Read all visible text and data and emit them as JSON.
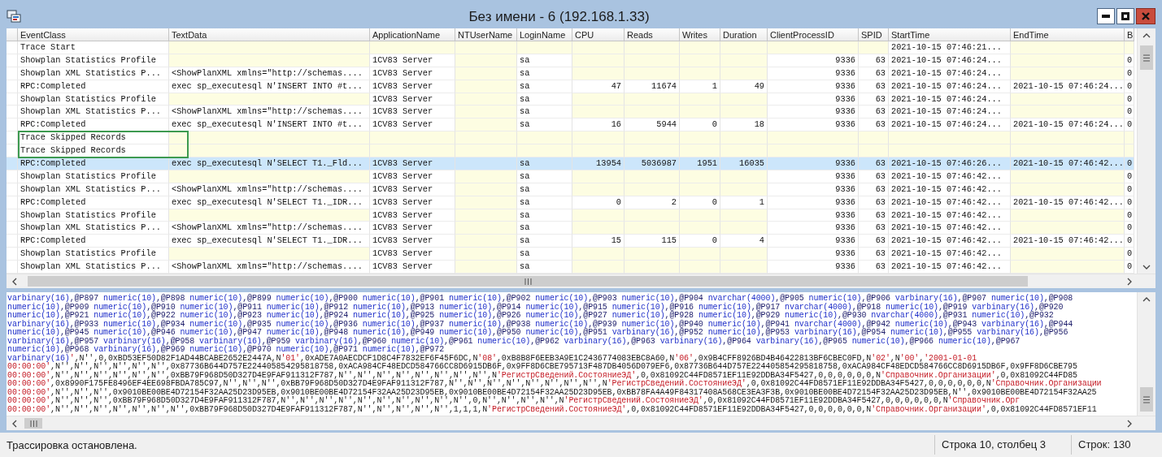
{
  "window": {
    "title": "Без имени - 6 (192.168.1.33)"
  },
  "table": {
    "columns": [
      {
        "label": "EventClass",
        "kind": "text"
      },
      {
        "label": "TextData",
        "kind": "text"
      },
      {
        "label": "ApplicationName",
        "kind": "text"
      },
      {
        "label": "NTUserName",
        "kind": "text"
      },
      {
        "label": "LoginName",
        "kind": "text"
      },
      {
        "label": "CPU",
        "kind": "number"
      },
      {
        "label": "Reads",
        "kind": "number"
      },
      {
        "label": "Writes",
        "kind": "number"
      },
      {
        "label": "Duration",
        "kind": "number"
      },
      {
        "label": "ClientProcessID",
        "kind": "number"
      },
      {
        "label": "SPID",
        "kind": "number"
      },
      {
        "label": "StartTime",
        "kind": "text"
      },
      {
        "label": "EndTime",
        "kind": "text"
      },
      {
        "label": "B",
        "kind": "text"
      }
    ],
    "rows": [
      {
        "selected": false,
        "highlighted": false,
        "cells": [
          "Trace Start",
          null,
          null,
          null,
          null,
          null,
          null,
          null,
          null,
          null,
          null,
          "2021-10-15 07:46:21...",
          null,
          null
        ]
      },
      {
        "selected": false,
        "highlighted": false,
        "cells": [
          "Showplan Statistics Profile",
          null,
          "1CV83 Server",
          null,
          "sa",
          null,
          null,
          null,
          null,
          "9336",
          "63",
          "2021-10-15 07:46:24...",
          null,
          "0"
        ]
      },
      {
        "selected": false,
        "highlighted": false,
        "cells": [
          "Showplan XML Statistics P...",
          "<ShowPlanXML xmlns=\"http://schemas....",
          "1CV83 Server",
          null,
          "sa",
          null,
          null,
          null,
          null,
          "9336",
          "63",
          "2021-10-15 07:46:24...",
          null,
          "0"
        ]
      },
      {
        "selected": false,
        "highlighted": false,
        "cells": [
          "RPC:Completed",
          "exec sp_executesql N'INSERT INTO #t...",
          "1CV83 Server",
          null,
          "sa",
          "47",
          "11674",
          "1",
          "49",
          "9336",
          "63",
          "2021-10-15 07:46:24...",
          "2021-10-15 07:46:24...",
          "0"
        ]
      },
      {
        "selected": false,
        "highlighted": false,
        "cells": [
          "Showplan Statistics Profile",
          null,
          "1CV83 Server",
          null,
          "sa",
          null,
          null,
          null,
          null,
          "9336",
          "63",
          "2021-10-15 07:46:24...",
          null,
          "0"
        ]
      },
      {
        "selected": false,
        "highlighted": false,
        "cells": [
          "Showplan XML Statistics P...",
          "<ShowPlanXML xmlns=\"http://schemas....",
          "1CV83 Server",
          null,
          "sa",
          null,
          null,
          null,
          null,
          "9336",
          "63",
          "2021-10-15 07:46:24...",
          null,
          "0"
        ]
      },
      {
        "selected": false,
        "highlighted": false,
        "cells": [
          "RPC:Completed",
          "exec sp_executesql N'INSERT INTO #t...",
          "1CV83 Server",
          null,
          "sa",
          "16",
          "5944",
          "0",
          "18",
          "9336",
          "63",
          "2021-10-15 07:46:24...",
          "2021-10-15 07:46:24...",
          "0"
        ]
      },
      {
        "selected": false,
        "highlighted": true,
        "cells": [
          "Trace Skipped Records",
          null,
          null,
          null,
          null,
          null,
          null,
          null,
          null,
          null,
          null,
          null,
          null,
          null
        ]
      },
      {
        "selected": false,
        "highlighted": true,
        "cells": [
          "Trace Skipped Records",
          null,
          null,
          null,
          null,
          null,
          null,
          null,
          null,
          null,
          null,
          null,
          null,
          null
        ]
      },
      {
        "selected": true,
        "highlighted": false,
        "cells": [
          "RPC:Completed",
          "exec sp_executesql N'SELECT T1._Fld...",
          "1CV83 Server",
          null,
          "sa",
          "13954",
          "5036987",
          "1951",
          "16035",
          "9336",
          "63",
          "2021-10-15 07:46:26...",
          "2021-10-15 07:46:42...",
          "0"
        ]
      },
      {
        "selected": false,
        "highlighted": false,
        "cells": [
          "Showplan Statistics Profile",
          null,
          "1CV83 Server",
          null,
          "sa",
          null,
          null,
          null,
          null,
          "9336",
          "63",
          "2021-10-15 07:46:42...",
          null,
          "0"
        ]
      },
      {
        "selected": false,
        "highlighted": false,
        "cells": [
          "Showplan XML Statistics P...",
          "<ShowPlanXML xmlns=\"http://schemas....",
          "1CV83 Server",
          null,
          "sa",
          null,
          null,
          null,
          null,
          "9336",
          "63",
          "2021-10-15 07:46:42...",
          null,
          "0"
        ]
      },
      {
        "selected": false,
        "highlighted": false,
        "cells": [
          "RPC:Completed",
          "exec sp_executesql N'SELECT T1._IDR...",
          "1CV83 Server",
          null,
          "sa",
          "0",
          "2",
          "0",
          "1",
          "9336",
          "63",
          "2021-10-15 07:46:42...",
          "2021-10-15 07:46:42...",
          "0"
        ]
      },
      {
        "selected": false,
        "highlighted": false,
        "cells": [
          "Showplan Statistics Profile",
          null,
          "1CV83 Server",
          null,
          "sa",
          null,
          null,
          null,
          null,
          "9336",
          "63",
          "2021-10-15 07:46:42...",
          null,
          "0"
        ]
      },
      {
        "selected": false,
        "highlighted": false,
        "cells": [
          "Showplan XML Statistics P...",
          "<ShowPlanXML xmlns=\"http://schemas....",
          "1CV83 Server",
          null,
          "sa",
          null,
          null,
          null,
          null,
          "9336",
          "63",
          "2021-10-15 07:46:42...",
          null,
          "0"
        ]
      },
      {
        "selected": false,
        "highlighted": false,
        "cells": [
          "RPC:Completed",
          "exec sp_executesql N'SELECT T1._IDR...",
          "1CV83 Server",
          null,
          "sa",
          "15",
          "115",
          "0",
          "4",
          "9336",
          "63",
          "2021-10-15 07:46:42...",
          "2021-10-15 07:46:42...",
          "0"
        ]
      },
      {
        "selected": false,
        "highlighted": false,
        "cells": [
          "Showplan Statistics Profile",
          null,
          "1CV83 Server",
          null,
          "sa",
          null,
          null,
          null,
          null,
          "9336",
          "63",
          "2021-10-15 07:46:42...",
          null,
          "0"
        ]
      },
      {
        "selected": false,
        "highlighted": false,
        "cells": [
          "Showplan XML Statistics P...",
          "<ShowPlanXML xmlns=\"http://schemas....",
          "1CV83 Server",
          null,
          "sa",
          null,
          null,
          null,
          null,
          "9336",
          "63",
          "2021-10-15 07:46:42...",
          null,
          "0"
        ]
      }
    ]
  },
  "text_panel": {
    "lines": [
      {
        "segments": [
          {
            "kind": "kw",
            "text": "varbinary(16)"
          },
          {
            "kind": "param",
            "text": ",@P897 "
          },
          {
            "kind": "kw",
            "text": "numeric(10)"
          },
          {
            "kind": "param",
            "text": ",@P898 "
          },
          {
            "kind": "kw",
            "text": "numeric(10)"
          },
          {
            "kind": "param",
            "text": ",@P899 "
          },
          {
            "kind": "kw",
            "text": "numeric(10)"
          },
          {
            "kind": "param",
            "text": ",@P900 "
          },
          {
            "kind": "kw",
            "text": "numeric(10)"
          },
          {
            "kind": "param",
            "text": ",@P901 "
          },
          {
            "kind": "kw",
            "text": "numeric(10)"
          },
          {
            "kind": "param",
            "text": ",@P902 "
          },
          {
            "kind": "kw",
            "text": "numeric(10)"
          },
          {
            "kind": "param",
            "text": ",@P903 "
          },
          {
            "kind": "kw",
            "text": "numeric(10)"
          },
          {
            "kind": "param",
            "text": ",@P904 "
          },
          {
            "kind": "kw",
            "text": "nvarchar(4000)"
          },
          {
            "kind": "param",
            "text": ",@P905 "
          },
          {
            "kind": "kw",
            "text": "numeric(10)"
          },
          {
            "kind": "param",
            "text": ",@P906 "
          },
          {
            "kind": "kw",
            "text": "varbinary(16)"
          },
          {
            "kind": "param",
            "text": ",@P907 "
          },
          {
            "kind": "kw",
            "text": "numeric(10)"
          },
          {
            "kind": "param",
            "text": ",@P908"
          }
        ]
      },
      {
        "segments": [
          {
            "kind": "kw",
            "text": "numeric(10)"
          },
          {
            "kind": "param",
            "text": ",@P909 "
          },
          {
            "kind": "kw",
            "text": "numeric(10)"
          },
          {
            "kind": "param",
            "text": ",@P910 "
          },
          {
            "kind": "kw",
            "text": "numeric(10)"
          },
          {
            "kind": "param",
            "text": ",@P911 "
          },
          {
            "kind": "kw",
            "text": "numeric(10)"
          },
          {
            "kind": "param",
            "text": ",@P912 "
          },
          {
            "kind": "kw",
            "text": "numeric(10)"
          },
          {
            "kind": "param",
            "text": ",@P913 "
          },
          {
            "kind": "kw",
            "text": "numeric(10)"
          },
          {
            "kind": "param",
            "text": ",@P914 "
          },
          {
            "kind": "kw",
            "text": "numeric(10)"
          },
          {
            "kind": "param",
            "text": ",@P915 "
          },
          {
            "kind": "kw",
            "text": "numeric(10)"
          },
          {
            "kind": "param",
            "text": ",@P916 "
          },
          {
            "kind": "kw",
            "text": "numeric(10)"
          },
          {
            "kind": "param",
            "text": ",@P917 "
          },
          {
            "kind": "kw",
            "text": "nvarchar(4000)"
          },
          {
            "kind": "param",
            "text": ",@P918 "
          },
          {
            "kind": "kw",
            "text": "numeric(10)"
          },
          {
            "kind": "param",
            "text": ",@P919 "
          },
          {
            "kind": "kw",
            "text": "varbinary(16)"
          },
          {
            "kind": "param",
            "text": ",@P920"
          }
        ]
      },
      {
        "segments": [
          {
            "kind": "kw",
            "text": "numeric(10)"
          },
          {
            "kind": "param",
            "text": ",@P921 "
          },
          {
            "kind": "kw",
            "text": "numeric(10)"
          },
          {
            "kind": "param",
            "text": ",@P922 "
          },
          {
            "kind": "kw",
            "text": "numeric(10)"
          },
          {
            "kind": "param",
            "text": ",@P923 "
          },
          {
            "kind": "kw",
            "text": "numeric(10)"
          },
          {
            "kind": "param",
            "text": ",@P924 "
          },
          {
            "kind": "kw",
            "text": "numeric(10)"
          },
          {
            "kind": "param",
            "text": ",@P925 "
          },
          {
            "kind": "kw",
            "text": "numeric(10)"
          },
          {
            "kind": "param",
            "text": ",@P926 "
          },
          {
            "kind": "kw",
            "text": "numeric(10)"
          },
          {
            "kind": "param",
            "text": ",@P927 "
          },
          {
            "kind": "kw",
            "text": "numeric(10)"
          },
          {
            "kind": "param",
            "text": ",@P928 "
          },
          {
            "kind": "kw",
            "text": "numeric(10)"
          },
          {
            "kind": "param",
            "text": ",@P929 "
          },
          {
            "kind": "kw",
            "text": "numeric(10)"
          },
          {
            "kind": "param",
            "text": ",@P930 "
          },
          {
            "kind": "kw",
            "text": "nvarchar(4000)"
          },
          {
            "kind": "param",
            "text": ",@P931 "
          },
          {
            "kind": "kw",
            "text": "numeric(10)"
          },
          {
            "kind": "param",
            "text": ",@P932"
          }
        ]
      },
      {
        "segments": [
          {
            "kind": "kw",
            "text": "varbinary(16)"
          },
          {
            "kind": "param",
            "text": ",@P933 "
          },
          {
            "kind": "kw",
            "text": "numeric(10)"
          },
          {
            "kind": "param",
            "text": ",@P934 "
          },
          {
            "kind": "kw",
            "text": "numeric(10)"
          },
          {
            "kind": "param",
            "text": ",@P935 "
          },
          {
            "kind": "kw",
            "text": "numeric(10)"
          },
          {
            "kind": "param",
            "text": ",@P936 "
          },
          {
            "kind": "kw",
            "text": "numeric(10)"
          },
          {
            "kind": "param",
            "text": ",@P937 "
          },
          {
            "kind": "kw",
            "text": "numeric(10)"
          },
          {
            "kind": "param",
            "text": ",@P938 "
          },
          {
            "kind": "kw",
            "text": "numeric(10)"
          },
          {
            "kind": "param",
            "text": ",@P939 "
          },
          {
            "kind": "kw",
            "text": "numeric(10)"
          },
          {
            "kind": "param",
            "text": ",@P940 "
          },
          {
            "kind": "kw",
            "text": "numeric(10)"
          },
          {
            "kind": "param",
            "text": ",@P941 "
          },
          {
            "kind": "kw",
            "text": "nvarchar(4000)"
          },
          {
            "kind": "param",
            "text": ",@P942 "
          },
          {
            "kind": "kw",
            "text": "numeric(10)"
          },
          {
            "kind": "param",
            "text": ",@P943 "
          },
          {
            "kind": "kw",
            "text": "varbinary(16)"
          },
          {
            "kind": "param",
            "text": ",@P944"
          }
        ]
      },
      {
        "segments": [
          {
            "kind": "kw",
            "text": "numeric(10)"
          },
          {
            "kind": "param",
            "text": ",@P945 "
          },
          {
            "kind": "kw",
            "text": "numeric(10)"
          },
          {
            "kind": "param",
            "text": ",@P946 "
          },
          {
            "kind": "kw",
            "text": "numeric(10)"
          },
          {
            "kind": "param",
            "text": ",@P947 "
          },
          {
            "kind": "kw",
            "text": "numeric(10)"
          },
          {
            "kind": "param",
            "text": ",@P948 "
          },
          {
            "kind": "kw",
            "text": "numeric(10)"
          },
          {
            "kind": "param",
            "text": ",@P949 "
          },
          {
            "kind": "kw",
            "text": "numeric(10)"
          },
          {
            "kind": "param",
            "text": ",@P950 "
          },
          {
            "kind": "kw",
            "text": "numeric(10)"
          },
          {
            "kind": "param",
            "text": ",@P951 "
          },
          {
            "kind": "kw",
            "text": "varbinary(16)"
          },
          {
            "kind": "param",
            "text": ",@P952 "
          },
          {
            "kind": "kw",
            "text": "numeric(10)"
          },
          {
            "kind": "param",
            "text": ",@P953 "
          },
          {
            "kind": "kw",
            "text": "varbinary(16)"
          },
          {
            "kind": "param",
            "text": ",@P954 "
          },
          {
            "kind": "kw",
            "text": "numeric(10)"
          },
          {
            "kind": "param",
            "text": ",@P955 "
          },
          {
            "kind": "kw",
            "text": "varbinary(16)"
          },
          {
            "kind": "param",
            "text": ",@P956"
          }
        ]
      },
      {
        "segments": [
          {
            "kind": "kw",
            "text": "varbinary(16)"
          },
          {
            "kind": "param",
            "text": ",@P957 "
          },
          {
            "kind": "kw",
            "text": "varbinary(16)"
          },
          {
            "kind": "param",
            "text": ",@P958 "
          },
          {
            "kind": "kw",
            "text": "varbinary(16)"
          },
          {
            "kind": "param",
            "text": ",@P959 "
          },
          {
            "kind": "kw",
            "text": "varbinary(16)"
          },
          {
            "kind": "param",
            "text": ",@P960 "
          },
          {
            "kind": "kw",
            "text": "numeric(10)"
          },
          {
            "kind": "param",
            "text": ",@P961 "
          },
          {
            "kind": "kw",
            "text": "numeric(10)"
          },
          {
            "kind": "param",
            "text": ",@P962 "
          },
          {
            "kind": "kw",
            "text": "varbinary(16)"
          },
          {
            "kind": "param",
            "text": ",@P963 "
          },
          {
            "kind": "kw",
            "text": "varbinary(16)"
          },
          {
            "kind": "param",
            "text": ",@P964 "
          },
          {
            "kind": "kw",
            "text": "varbinary(16)"
          },
          {
            "kind": "param",
            "text": ",@P965 "
          },
          {
            "kind": "kw",
            "text": "numeric(10)"
          },
          {
            "kind": "param",
            "text": ",@P966 "
          },
          {
            "kind": "kw",
            "text": "numeric(10)"
          },
          {
            "kind": "param",
            "text": ",@P967"
          }
        ]
      },
      {
        "segments": [
          {
            "kind": "kw",
            "text": "numeric(10)"
          },
          {
            "kind": "param",
            "text": ",@P968 "
          },
          {
            "kind": "kw",
            "text": "varbinary(16)"
          },
          {
            "kind": "param",
            "text": ",@P969 "
          },
          {
            "kind": "kw",
            "text": "numeric(10)"
          },
          {
            "kind": "param",
            "text": ",@P970 "
          },
          {
            "kind": "kw",
            "text": "numeric(10)"
          },
          {
            "kind": "param",
            "text": ",@P971 "
          },
          {
            "kind": "kw",
            "text": "numeric(10)"
          },
          {
            "kind": "param",
            "text": ",@P972"
          }
        ]
      },
      {
        "segments": [
          {
            "kind": "kw",
            "text": "varbinary(16)"
          },
          {
            "kind": "str",
            "text": "'"
          },
          {
            "kind": "plain",
            "text": ",N'',0,0xBD53EF50D82F1AD44BCABE2652E2447A,N"
          },
          {
            "kind": "str",
            "text": "'01'"
          },
          {
            "kind": "plain",
            "text": ",0xADE7A0AECDCF1D8C4F7832EF6F45F6DC,N"
          },
          {
            "kind": "str",
            "text": "'08'"
          },
          {
            "kind": "plain",
            "text": ",0xB8B8F6EEB3A9E1C2436774083EBC8A60,N"
          },
          {
            "kind": "str",
            "text": "'06'"
          },
          {
            "kind": "plain",
            "text": ",0x9B4CFF8926BD4B46422813BF6CBEC0FD,N"
          },
          {
            "kind": "str",
            "text": "'02'"
          },
          {
            "kind": "plain",
            "text": ",N"
          },
          {
            "kind": "str",
            "text": "'00'"
          },
          {
            "kind": "plain",
            "text": ","
          },
          {
            "kind": "str",
            "text": "'2001-01-01"
          }
        ]
      },
      {
        "segments": [
          {
            "kind": "str",
            "text": "00:00:00'"
          },
          {
            "kind": "plain",
            "text": ",N'',N'',N'',N'',N'',N'',0x87736B644D757E224405854295818758,0xACA984CF48EDCD584766CC8D6915DB6F,0x9FF8D6CBE795713F487DB4056D079EF6,0x87736B644D757E224405854295818758,0xACA984CF48EDCD584766CC8D6915DB6F,0x9FF8D6CBE795"
          }
        ]
      },
      {
        "segments": [
          {
            "kind": "str",
            "text": "00:00:00'"
          },
          {
            "kind": "plain",
            "text": ",N'',N'',N'',N'',N'',N'',0xBB79F968D50D327D4E9FAF911312F787,N'',N'',N'',N'',N'',N'',N'',N'',N"
          },
          {
            "kind": "str",
            "text": "'РегистрСведений.СостояниеЭД'"
          },
          {
            "kind": "plain",
            "text": ",0,0x81092C44FD8571EF11E92DDBA34F5427,0,0,0,0,0,0,N"
          },
          {
            "kind": "str",
            "text": "'Справочник.Организации'"
          },
          {
            "kind": "plain",
            "text": ",0,0x81092C44FD85"
          }
        ]
      },
      {
        "segments": [
          {
            "kind": "str",
            "text": "00:00:00'"
          },
          {
            "kind": "plain",
            "text": ",0x8990F175FE8496EF4EE698FBDA785C97,N'',N'',N'',0xBB79F968D50D327D4E9FAF911312F787,N'',N'',N'',N'',N'',N'',N'',N'',N"
          },
          {
            "kind": "str",
            "text": "'РегистрСведений.СостояниеЭД'"
          },
          {
            "kind": "plain",
            "text": ",0,0x81092C44FD8571EF11E92DDBA34F5427,0,0,0,0,0,0,N"
          },
          {
            "kind": "str",
            "text": "'Справочник.Организации"
          }
        ]
      },
      {
        "segments": [
          {
            "kind": "str",
            "text": "00:00:00'"
          },
          {
            "kind": "plain",
            "text": ",N'',N'',N'',0x9010BE00BE4D72154F32AA25D23D95EB,0x9010BE00BE4D72154F32AA25D23D95EB,0x9010BE00BE4D72154F32AA25D23D95EB,0xBB78FA4A49F84317408A568CE3EA3F3B,0x9010BE00BE4D72154F32AA25D23D95EB,N'',0x9010BE00BE4D72154F32AA25"
          }
        ]
      },
      {
        "segments": [
          {
            "kind": "str",
            "text": "00:00:00'"
          },
          {
            "kind": "plain",
            "text": ",N'',N'',N'',0xBB79F968D50D327D4E9FAF911312F787,N'',N'',N'',N'',N'',N'',N'',N'',N'',N'',0,N'',N'',N'',N'',N"
          },
          {
            "kind": "str",
            "text": "'РегистрСведений.СостояниеЭД'"
          },
          {
            "kind": "plain",
            "text": ",0,0x81092C44FD8571EF11E92DDBA34F5427,0,0,0,0,0,0,N"
          },
          {
            "kind": "str",
            "text": "'Справочник.Орг"
          }
        ]
      },
      {
        "segments": [
          {
            "kind": "str",
            "text": "00:00:00'"
          },
          {
            "kind": "plain",
            "text": ",N'',N'',N'',N'',N'',N'',N'',0xBB79F968D50D327D4E9FAF911312F787,N'',N'',N'',N'',N'',1,1,1,N"
          },
          {
            "kind": "str",
            "text": "'РегистрСведений.СостояниеЭД'"
          },
          {
            "kind": "plain",
            "text": ",0,0x81092C44FD8571EF11E92DDBA34F5427,0,0,0,0,0,0,N"
          },
          {
            "kind": "str",
            "text": "'Справочник.Организации'"
          },
          {
            "kind": "plain",
            "text": ",0,0x81092C44FD8571EF11"
          }
        ]
      }
    ]
  },
  "status_bar": {
    "message": "Трассировка остановлена.",
    "position": "Строка 10, столбец 3",
    "count": "Строк: 130"
  }
}
